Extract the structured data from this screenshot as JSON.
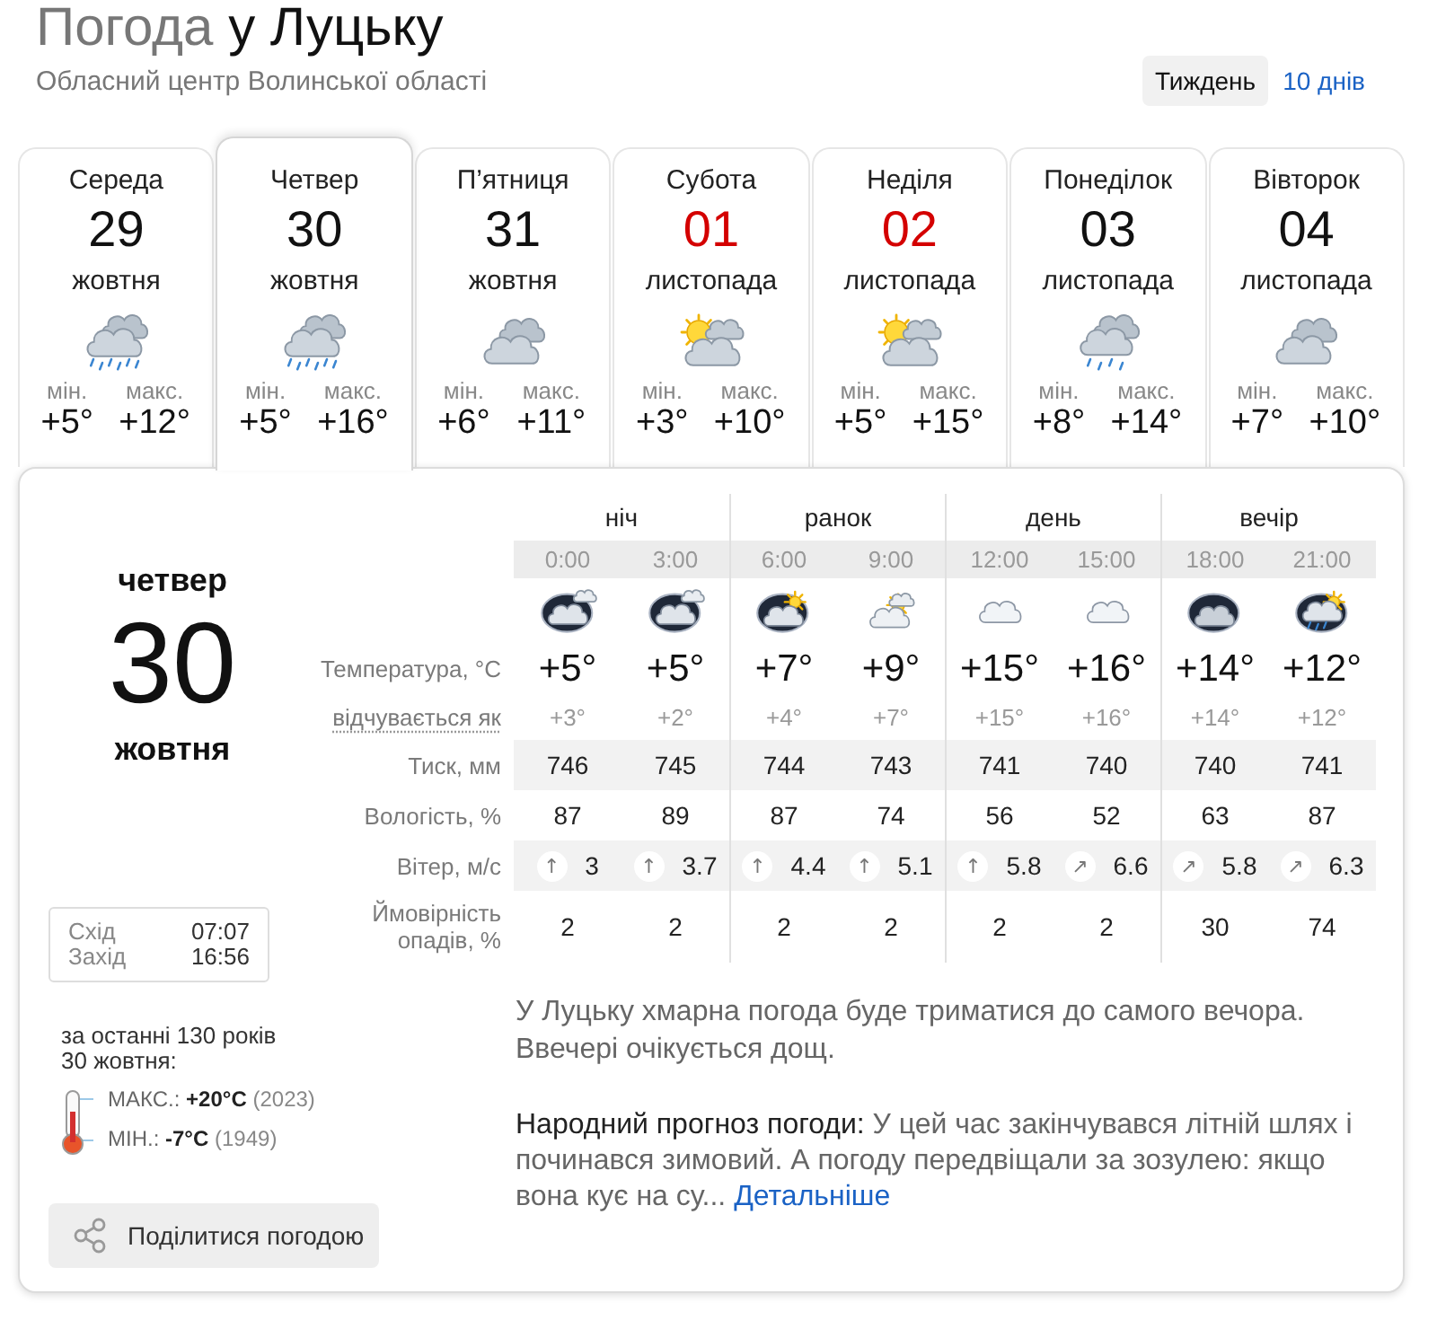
{
  "header": {
    "title": {
      "lead": "Погода",
      "place": "у Луцьку"
    },
    "subtitle": "Обласний центр Волинської області",
    "ranges": [
      {
        "label": "Тиждень",
        "selected": true
      },
      {
        "label": "10 днів",
        "selected": false
      }
    ]
  },
  "days": [
    {
      "weekday": "Середа",
      "date": "29",
      "month": "жовтня",
      "kind": "rain",
      "min_label": "мін.",
      "min": "+5°",
      "max_label": "макс.",
      "max": "+12°",
      "weekend": false,
      "selected": false
    },
    {
      "weekday": "Четвер",
      "date": "30",
      "month": "жовтня",
      "kind": "rain",
      "min_label": "мін.",
      "min": "+5°",
      "max_label": "макс.",
      "max": "+16°",
      "weekend": false,
      "selected": true
    },
    {
      "weekday": "П’ятниця",
      "date": "31",
      "month": "жовтня",
      "kind": "cloudy",
      "min_label": "мін.",
      "min": "+6°",
      "max_label": "макс.",
      "max": "+11°",
      "weekend": false,
      "selected": false
    },
    {
      "weekday": "Субота",
      "date": "01",
      "month": "листопада",
      "kind": "sun-cloud",
      "min_label": "мін.",
      "min": "+3°",
      "max_label": "макс.",
      "max": "+10°",
      "weekend": true,
      "selected": false
    },
    {
      "weekday": "Неділя",
      "date": "02",
      "month": "листопада",
      "kind": "sun-cloud",
      "min_label": "мін.",
      "min": "+5°",
      "max_label": "макс.",
      "max": "+15°",
      "weekend": true,
      "selected": false
    },
    {
      "weekday": "Понеділок",
      "date": "03",
      "month": "листопада",
      "kind": "light-rain",
      "min_label": "мін.",
      "min": "+8°",
      "max_label": "макс.",
      "max": "+14°",
      "weekend": false,
      "selected": false
    },
    {
      "weekday": "Вівторок",
      "date": "04",
      "month": "листопада",
      "kind": "cloudy",
      "min_label": "мін.",
      "min": "+7°",
      "max_label": "макс.",
      "max": "+10°",
      "weekend": false,
      "selected": false
    }
  ],
  "detail": {
    "weekday": "четвер",
    "date": "30",
    "month": "жовтня",
    "sun": [
      {
        "label": "Схід",
        "time": "07:07"
      },
      {
        "label": "Захід",
        "time": "16:56"
      }
    ],
    "records": {
      "title": [
        "за останні 130 років",
        "30 жовтня:"
      ],
      "items": [
        {
          "label": "МАКС.:",
          "value": "+20°C",
          "year": "(2023)"
        },
        {
          "label": "МІН.:",
          "value": "-7°C",
          "year": "(1949)"
        }
      ]
    },
    "share": "Поділитися погодою"
  },
  "hourly": {
    "periods": [
      "ніч",
      "ранок",
      "день",
      "вечір"
    ],
    "labels": {
      "temperature": "Температура, °C",
      "feels": "відчувається як",
      "pressure": "Тиск, мм",
      "humidity": "Вологість, %",
      "wind": "Вітер, м/с",
      "precip": "Ймовірність опадів, %"
    },
    "hours": [
      {
        "time": "0:00",
        "kind": "night-cloudy",
        "temp": "+5°",
        "feels": "+3°",
        "pressure": "746",
        "humidity": "87",
        "wind_arrow": "↑",
        "wind": "3",
        "precip": "2"
      },
      {
        "time": "3:00",
        "kind": "night-cloudy",
        "temp": "+5°",
        "feels": "+2°",
        "pressure": "745",
        "humidity": "89",
        "wind_arrow": "↑",
        "wind": "3.7",
        "precip": "2"
      },
      {
        "time": "6:00",
        "kind": "night-sun-cloudy",
        "temp": "+7°",
        "feels": "+4°",
        "pressure": "744",
        "humidity": "87",
        "wind_arrow": "↑",
        "wind": "4.4",
        "precip": "2"
      },
      {
        "time": "9:00",
        "kind": "sun-cloudy",
        "temp": "+9°",
        "feels": "+7°",
        "pressure": "743",
        "humidity": "74",
        "wind_arrow": "↑",
        "wind": "5.1",
        "precip": "2"
      },
      {
        "time": "12:00",
        "kind": "cloud",
        "temp": "+15°",
        "feels": "+15°",
        "pressure": "741",
        "humidity": "56",
        "wind_arrow": "↑",
        "wind": "5.8",
        "precip": "2"
      },
      {
        "time": "15:00",
        "kind": "cloud",
        "temp": "+16°",
        "feels": "+16°",
        "pressure": "740",
        "humidity": "52",
        "wind_arrow": "↗",
        "wind": "6.6",
        "precip": "2"
      },
      {
        "time": "18:00",
        "kind": "night-overcast",
        "temp": "+14°",
        "feels": "+14°",
        "pressure": "740",
        "humidity": "63",
        "wind_arrow": "↗",
        "wind": "5.8",
        "precip": "30"
      },
      {
        "time": "21:00",
        "kind": "night-sun-rain",
        "temp": "+12°",
        "feels": "+12°",
        "pressure": "741",
        "humidity": "87",
        "wind_arrow": "↗",
        "wind": "6.3",
        "precip": "74"
      }
    ]
  },
  "summary": "У Луцьку хмарна погода буде триматися до самого вечора. Ввечері очікується дощ.",
  "folk": {
    "label": "Народний прогноз погоди:",
    "text": "У цей час закінчувався літній шлях і починався зимовий. А погоду передвіщали за зозулею: якщо вона кує на су...",
    "link": "Детальніше"
  }
}
